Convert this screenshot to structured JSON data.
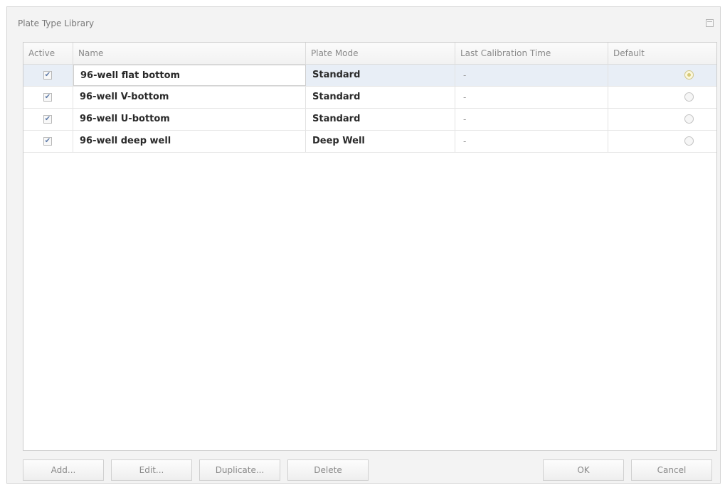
{
  "dialog": {
    "title": "Plate Type Library",
    "maximize_icon": "maximize-icon"
  },
  "table": {
    "headers": {
      "active": "Active",
      "name": "Name",
      "plate_mode": "Plate Mode",
      "last_calibration_time": "Last Calibration Time",
      "default": "Default"
    },
    "rows": [
      {
        "active": true,
        "name": "96-well flat bottom",
        "plate_mode": "Standard",
        "last_calibration_time": "-",
        "default": true
      },
      {
        "active": true,
        "name": "96-well V-bottom",
        "plate_mode": "Standard",
        "last_calibration_time": "-",
        "default": false
      },
      {
        "active": true,
        "name": "96-well U-bottom",
        "plate_mode": "Standard",
        "last_calibration_time": "-",
        "default": false
      },
      {
        "active": true,
        "name": "96-well deep well",
        "plate_mode": "Deep Well",
        "last_calibration_time": "-",
        "default": false
      }
    ],
    "selected_row": 0
  },
  "buttons": {
    "add": "Add...",
    "edit": "Edit...",
    "duplicate": "Duplicate...",
    "delete": "Delete",
    "ok": "OK",
    "cancel": "Cancel"
  }
}
